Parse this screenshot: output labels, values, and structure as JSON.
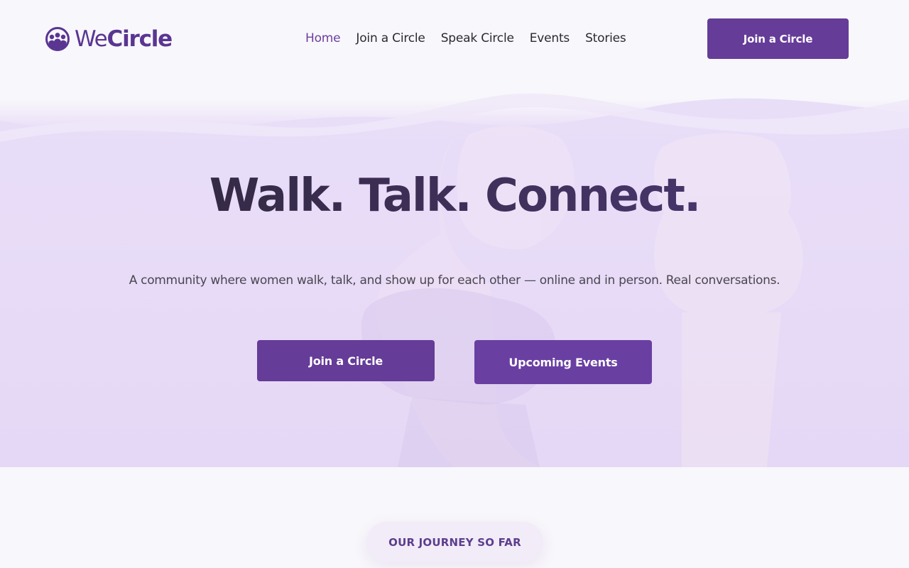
{
  "brand": {
    "name_part1": "We",
    "name_part2": "Circle",
    "logo_icon": "three-people-circle-icon",
    "accent_color": "#653c98"
  },
  "nav": {
    "items": [
      {
        "label": "Home",
        "active": true
      },
      {
        "label": "Join a Circle",
        "active": false
      },
      {
        "label": "Speak Circle",
        "active": false
      },
      {
        "label": "Events",
        "active": false
      },
      {
        "label": "Stories",
        "active": false
      }
    ],
    "cta_label": "Join a Circle"
  },
  "hero": {
    "title": "Walk. Talk. Connect.",
    "subtitle": "A community where women walk, talk, and show up for each other — online and in person. Real conversations.",
    "primary_button": "Join a Circle",
    "secondary_button": "Upcoming Events"
  },
  "journey": {
    "badge": "OUR JOURNEY SO FAR"
  }
}
